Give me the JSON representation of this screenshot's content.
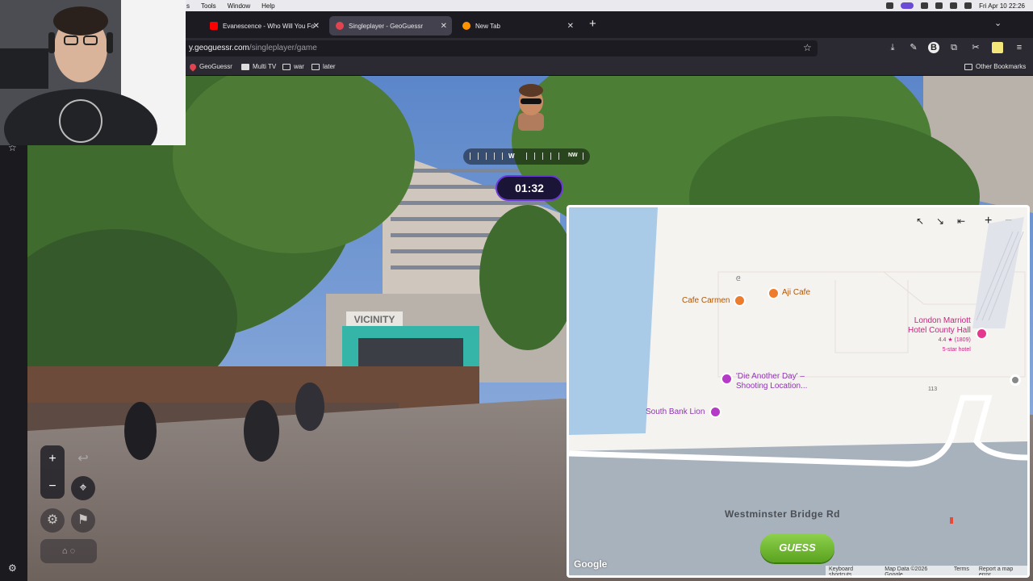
{
  "menubar": {
    "items": [
      "s",
      "Tools",
      "Window",
      "Help"
    ],
    "clock": "Fri Apr 10  22:26"
  },
  "tabs": [
    {
      "label": "Evanescence - Who Will You Fo",
      "favicon_color": "#ff0000"
    },
    {
      "label": "Singleplayer - GeoGuessr",
      "favicon_color": "#e2444f"
    },
    {
      "label": "New Tab",
      "favicon_color": "#ff9400"
    }
  ],
  "url": {
    "prefix": "y.geoguessr.com",
    "path": "/singleplayer/game"
  },
  "bookmarks": [
    "GeoGuessr",
    "Multi TV",
    "war",
    "later"
  ],
  "other_bookmarks": "Other Bookmarks",
  "game": {
    "compass": [
      "W",
      "NW"
    ],
    "timer": "01:32",
    "sign_text": "VICINITY",
    "guess_label": "GUESS"
  },
  "map": {
    "places": {
      "cafe_carmen": "Cafe Carmen",
      "aji_cafe": "Aji Cafe",
      "hotel_line1": "London Marriott",
      "hotel_line2": "Hotel County Hall",
      "hotel_rating": "4.4 ★ (1809)",
      "hotel_type": "5-star hotel",
      "die_line1": "'Die Another Day' –",
      "die_line2": "Shooting Location...",
      "south_bank_lion": "South Bank Lion",
      "road": "Westminster Bridge Rd",
      "number_113": "113"
    },
    "attribution": {
      "logo": "Google",
      "shortcuts": "Keyboard shortcuts",
      "data": "Map Data ©2026 Google",
      "terms": "Terms",
      "report": "Report a map error"
    },
    "zoom_in": "+",
    "zoom_out": "−"
  },
  "colors": {
    "accent": "#6c3ad8",
    "guess_green": "#6cb52d",
    "water": "#a9cbe8",
    "road": "#a8b2bd"
  }
}
